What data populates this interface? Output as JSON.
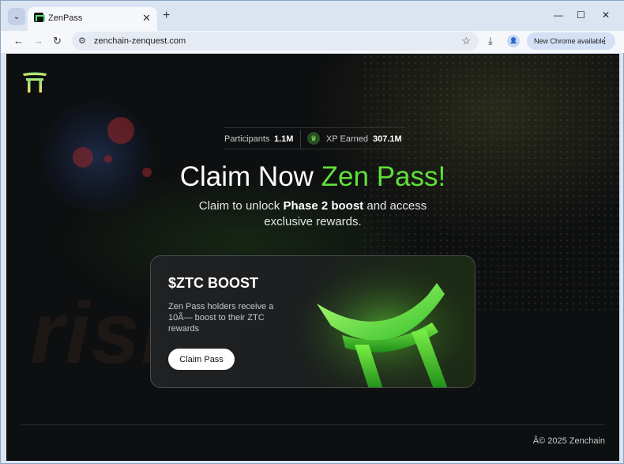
{
  "browser": {
    "tab_title": "ZenPass",
    "tab_close": "✕",
    "new_tab": "+",
    "tab_menu": "⌄",
    "url": "zenchain-zenquest.com",
    "update_label": "New Chrome available",
    "update_menu": "⋮",
    "back": "←",
    "forward": "→",
    "reload": "↻",
    "site_info": "⚙",
    "bookmark": "☆",
    "download": "⤓",
    "minimize": "—",
    "maximize": "☐",
    "close": "✕"
  },
  "page": {
    "stats": {
      "participants_label": "Participants",
      "participants_value": "1.1M",
      "xp_label": "XP Earned",
      "xp_value": "307.1M",
      "xp_icon": "trophy-icon"
    },
    "headline_main": "Claim Now ",
    "headline_accent": "Zen Pass!",
    "sub_part1": "Claim to unlock ",
    "sub_bold": "Phase 2 boost",
    "sub_part2": " and access exclusive rewards.",
    "card": {
      "title": "$ZTC BOOST",
      "description": "Zen Pass holders receive a 10Ã— boost to their ZTC rewards",
      "button": "Claim Pass"
    },
    "footer": "Â© 2025 Zenchain",
    "watermark": "risk.com",
    "colors": {
      "accent": "#5fe03a",
      "background": "#0e0f10"
    }
  }
}
